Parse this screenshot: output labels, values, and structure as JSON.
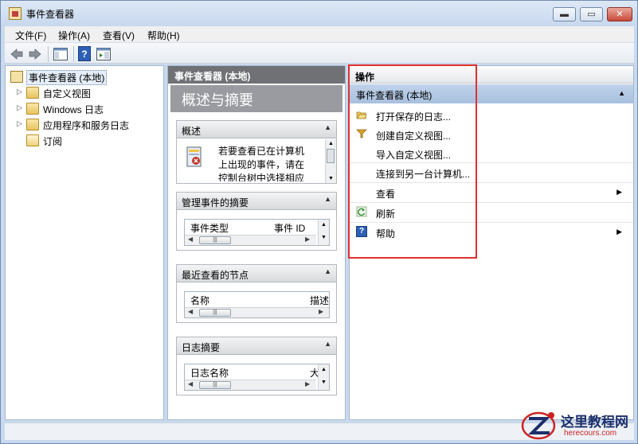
{
  "window": {
    "title": "事件查看器",
    "minimize_glyph": "▬",
    "maximize_glyph": "▭",
    "close_glyph": "✕"
  },
  "menu": {
    "file": "文件(F)",
    "action": "操作(A)",
    "view": "查看(V)",
    "help": "帮助(H)"
  },
  "toolbar": {
    "back_icon": "back-arrow-icon",
    "forward_icon": "forward-arrow-icon",
    "help_glyph": "?"
  },
  "tree": {
    "items": [
      {
        "label": "事件查看器 (本地)",
        "expanded": true,
        "selected": true,
        "icon": "event-viewer-icon"
      },
      {
        "label": "自定义视图",
        "arrow": "▷",
        "icon": "folder-icon"
      },
      {
        "label": "Windows 日志",
        "arrow": "▷",
        "icon": "folder-icon"
      },
      {
        "label": "应用程序和服务日志",
        "arrow": "▷",
        "icon": "folder-icon"
      },
      {
        "label": "订阅",
        "icon": "subscription-icon"
      }
    ]
  },
  "middle": {
    "header": "事件查看器 (本地)",
    "title": "概述与摘要",
    "overview": {
      "title": "概述",
      "text_line1": "若要查看已在计算机",
      "text_line2": "上出现的事件，请在",
      "text_line3": "控制台树中选择相应"
    },
    "admin_summary": {
      "title": "管理事件的摘要",
      "col1": "事件类型",
      "col2": "事件 ID"
    },
    "recent_nodes": {
      "title": "最近查看的节点",
      "col1": "名称",
      "col2": "描述"
    },
    "log_summary": {
      "title": "日志摘要",
      "col1": "日志名称",
      "col2": "大"
    },
    "collapse_glyph": "▲"
  },
  "actions": {
    "header": "操作",
    "section_title": "事件查看器 (本地)",
    "collapse_glyph": "▲",
    "submenu_glyph": "▶",
    "items": [
      {
        "label": "打开保存的日志...",
        "icon": "open-folder-icon"
      },
      {
        "label": "创建自定义视图...",
        "icon": "filter-icon"
      },
      {
        "label": "导入自定义视图..."
      },
      {
        "label": "连接到另一台计算机..."
      },
      {
        "label": "查看",
        "submenu": true
      },
      {
        "label": "刷新",
        "icon": "refresh-icon"
      },
      {
        "label": "帮助",
        "icon": "help-icon",
        "submenu": true
      }
    ]
  },
  "watermark": {
    "name": "这里教程网",
    "url": "herecours.com"
  }
}
